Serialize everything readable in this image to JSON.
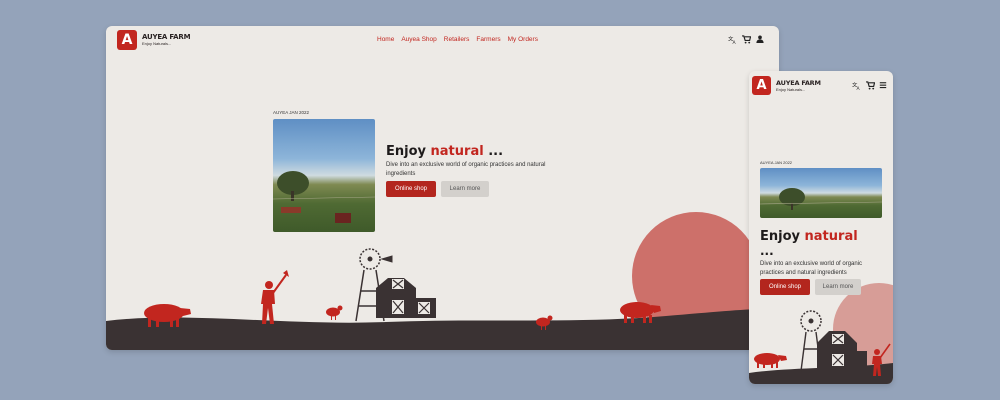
{
  "brand": {
    "logo_letter": "A",
    "name": "AUYEA FARM",
    "tagline": "Enjoy Naturals..."
  },
  "nav": {
    "items": [
      "Home",
      "Auyea Shop",
      "Retailers",
      "Farmers",
      "My Orders"
    ]
  },
  "icons": {
    "translate": "translate-icon",
    "cart": "cart-icon",
    "user": "user-icon",
    "menu": "hamburger-menu-icon"
  },
  "hero": {
    "date": "AUYEA JAN 2022",
    "headline_prefix": "Enjoy",
    "headline_accent": "natural",
    "headline_suffix": "...",
    "description": "Dive into an exclusive world of organic practices and natural ingredients",
    "primary_button": "Online shop",
    "secondary_button": "Learn more"
  },
  "colors": {
    "accent": "#c2261f",
    "background": "#edeae6",
    "page_background": "#94a3ba",
    "sun": "#cd706a",
    "ground": "#3a3233",
    "animal": "#c2261f"
  }
}
